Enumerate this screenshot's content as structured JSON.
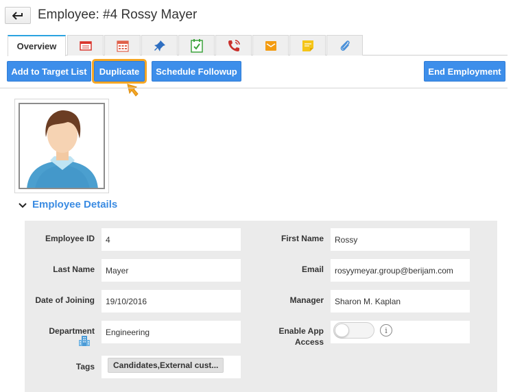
{
  "header": {
    "title": "Employee: #4 Rossy Mayer"
  },
  "tabs": [
    {
      "label": "Overview",
      "icon": "overview",
      "active": true
    },
    {
      "label": "",
      "icon": "calendar-list-icon"
    },
    {
      "label": "",
      "icon": "calendar-grid-icon"
    },
    {
      "label": "",
      "icon": "pin-icon"
    },
    {
      "label": "",
      "icon": "task-check-icon"
    },
    {
      "label": "",
      "icon": "phone-call-icon"
    },
    {
      "label": "",
      "icon": "email-icon"
    },
    {
      "label": "",
      "icon": "note-icon"
    },
    {
      "label": "",
      "icon": "attachment-icon"
    }
  ],
  "actions": {
    "add_to_target": "Add to Target List",
    "duplicate": "Duplicate",
    "schedule_followup": "Schedule Followup",
    "end_employment": "End Employment"
  },
  "section": {
    "title": "Employee Details"
  },
  "fields": {
    "employee_id_label": "Employee ID",
    "employee_id": "4",
    "first_name_label": "First Name",
    "first_name": "Rossy",
    "last_name_label": "Last Name",
    "last_name": "Mayer",
    "email_label": "Email",
    "email": "rosyymeyar.group@berijam.com",
    "date_of_joining_label": "Date of Joining",
    "date_of_joining": "19/10/2016",
    "manager_label": "Manager",
    "manager": "Sharon M. Kaplan",
    "department_label": "Department",
    "department": "Engineering",
    "enable_app_access_label_1": "Enable App",
    "enable_app_access_label_2": "Access",
    "enable_app_access": false,
    "tags_label": "Tags",
    "tags": "Candidates,External cust..."
  },
  "colors": {
    "primary": "#3d8eea",
    "highlight": "#f5a623",
    "section_title": "#3a8be2",
    "active_tab_accent": "#29a3e0"
  }
}
